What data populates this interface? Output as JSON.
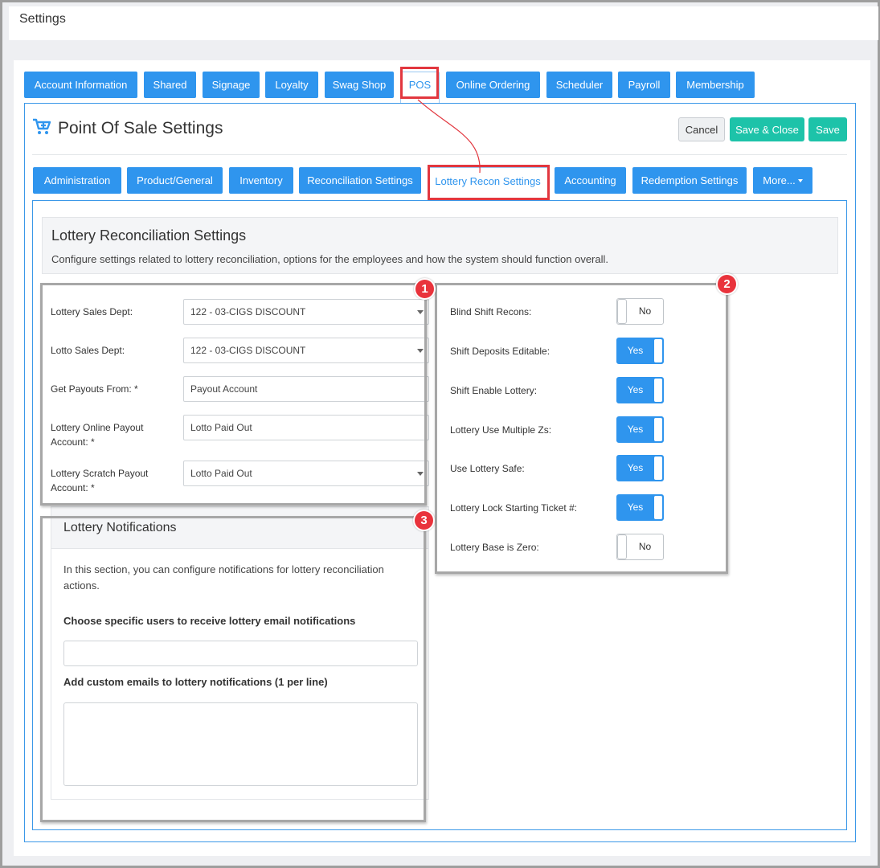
{
  "window": {
    "title": "Settings"
  },
  "top_tabs": [
    {
      "label": "Account Information"
    },
    {
      "label": "Shared"
    },
    {
      "label": "Signage"
    },
    {
      "label": "Loyalty"
    },
    {
      "label": "Swag Shop"
    },
    {
      "label": "POS"
    },
    {
      "label": "Online Ordering"
    },
    {
      "label": "Scheduler"
    },
    {
      "label": "Payroll"
    },
    {
      "label": "Membership"
    }
  ],
  "page": {
    "title": "Point Of Sale Settings",
    "icon": "cart-plus-icon",
    "cancel_label": "Cancel",
    "save_close_label": "Save & Close",
    "save_label": "Save"
  },
  "sub_tabs": [
    {
      "label": "Administration"
    },
    {
      "label": "Product/General"
    },
    {
      "label": "Inventory"
    },
    {
      "label": "Reconciliation Settings"
    },
    {
      "label": "Lottery Recon Settings"
    },
    {
      "label": "Accounting"
    },
    {
      "label": "Redemption Settings"
    },
    {
      "label": "More..."
    }
  ],
  "section": {
    "heading": "Lottery Reconciliation Settings",
    "description": "Configure settings related to lottery reconciliation, options for the employees and how the system should function overall."
  },
  "badges": [
    "1",
    "2",
    "3"
  ],
  "fields": [
    {
      "label": "Lottery Sales Dept:",
      "value": "122 - 03-CIGS DISCOUNT"
    },
    {
      "label": "Lotto Sales Dept:",
      "value": "122 - 03-CIGS DISCOUNT"
    },
    {
      "label": "Get Payouts From: *",
      "value": "Payout Account"
    },
    {
      "label_line1": "Lottery Online Payout",
      "label_line2": "Account: *",
      "value": "Lotto Paid Out"
    },
    {
      "label_line1": "Lottery Scratch Payout",
      "label_line2": "Account: *",
      "value": "Lotto Paid Out"
    }
  ],
  "toggles": [
    {
      "label": "Blind Shift Recons:",
      "state": "No"
    },
    {
      "label": "Shift Deposits Editable:",
      "state": "Yes"
    },
    {
      "label": "Shift Enable Lottery:",
      "state": "Yes"
    },
    {
      "label": "Lottery Use Multiple Zs:",
      "state": "Yes"
    },
    {
      "label": "Use Lottery Safe:",
      "state": "Yes"
    },
    {
      "label": "Lottery Lock Starting Ticket #:",
      "state": "Yes"
    },
    {
      "label": "Lottery Base is Zero:",
      "state": "No"
    }
  ],
  "notifications": {
    "heading": "Lottery Notifications",
    "desc_line1": "In this section, you can configure notifications for lottery reconciliation",
    "desc_line2": "actions.",
    "users_label": "Choose specific users to receive lottery email notifications",
    "users_value": "",
    "custom_label": "Add custom emails to lottery notifications (1 per line)",
    "custom_value": ""
  },
  "colors": {
    "tab_blue": "#2f95ee",
    "teal": "#1dc3a9",
    "highlight_red": "#e2373f"
  }
}
